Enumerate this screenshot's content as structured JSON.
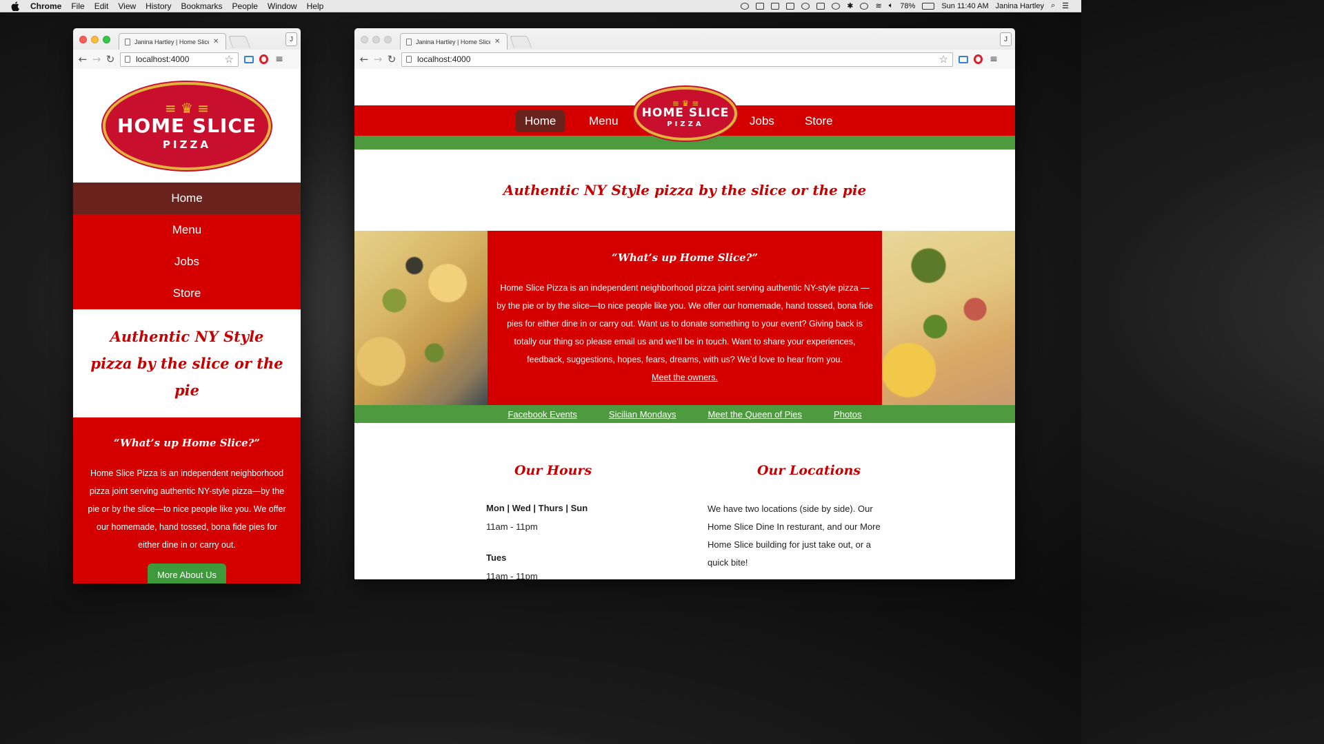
{
  "menubar": {
    "app": "Chrome",
    "items": [
      "File",
      "Edit",
      "View",
      "History",
      "Bookmarks",
      "People",
      "Window",
      "Help"
    ],
    "battery": "78%",
    "clock": "Sun 11:40 AM",
    "user": "Janina Hartley"
  },
  "browser": {
    "tab_title": "Janina Hartley | Home Slice",
    "url": "localhost:4000",
    "profile_initial": "J"
  },
  "site": {
    "logo": {
      "brand": "HOME SLICE",
      "sub": "PIZZA",
      "registered": "®"
    },
    "nav": [
      "Home",
      "Menu",
      "Jobs",
      "Store"
    ],
    "tagline": "Authentic NY Style pizza by the slice or the pie",
    "about_heading": "“What’s up Home Slice?”",
    "about_short": "Home Slice Pizza is an independent neighborhood pizza joint serving authentic NY-style pizza—by the pie or by the slice—to nice people like you. We offer our homemade, hand tossed, bona fide pies for either dine in or carry out.",
    "about_long": "Home Slice Pizza is an independent neighborhood pizza joint serving authentic NY-style pizza —by the pie or by the slice—to nice people like you. We offer our homemade, hand tossed, bona fide pies for either dine in or carry out. Want us to donate something to your event? Giving back is totally our thing so please email us and we’ll be in touch. Want to share your experiences, feedback, suggestions, hopes, fears, dreams, with us? We’d love to hear from you.",
    "meet_owners": "Meet the owners.",
    "more_button": "More About Us",
    "sub_links": [
      "Facebook Events",
      "Sicilian Mondays",
      "Meet the Queen of Pies",
      "Photos"
    ],
    "hours_heading": "Our Hours",
    "locations_heading": "Our Locations",
    "hours": [
      {
        "days": "Mon | Wed | Thurs | Sun",
        "time": "11am - 11pm"
      },
      {
        "days": "Tues",
        "time": "11am - 11pm"
      }
    ],
    "locations_text": "We have two locations (side by side). Our Home Slice Dine In resturant, and our More Home Slice building for just take out, or a quick bite!"
  },
  "colors": {
    "brand_red": "#d40000",
    "active_nav": "#6a221d",
    "green": "#4e9a3f",
    "gold": "#e2b33c"
  }
}
